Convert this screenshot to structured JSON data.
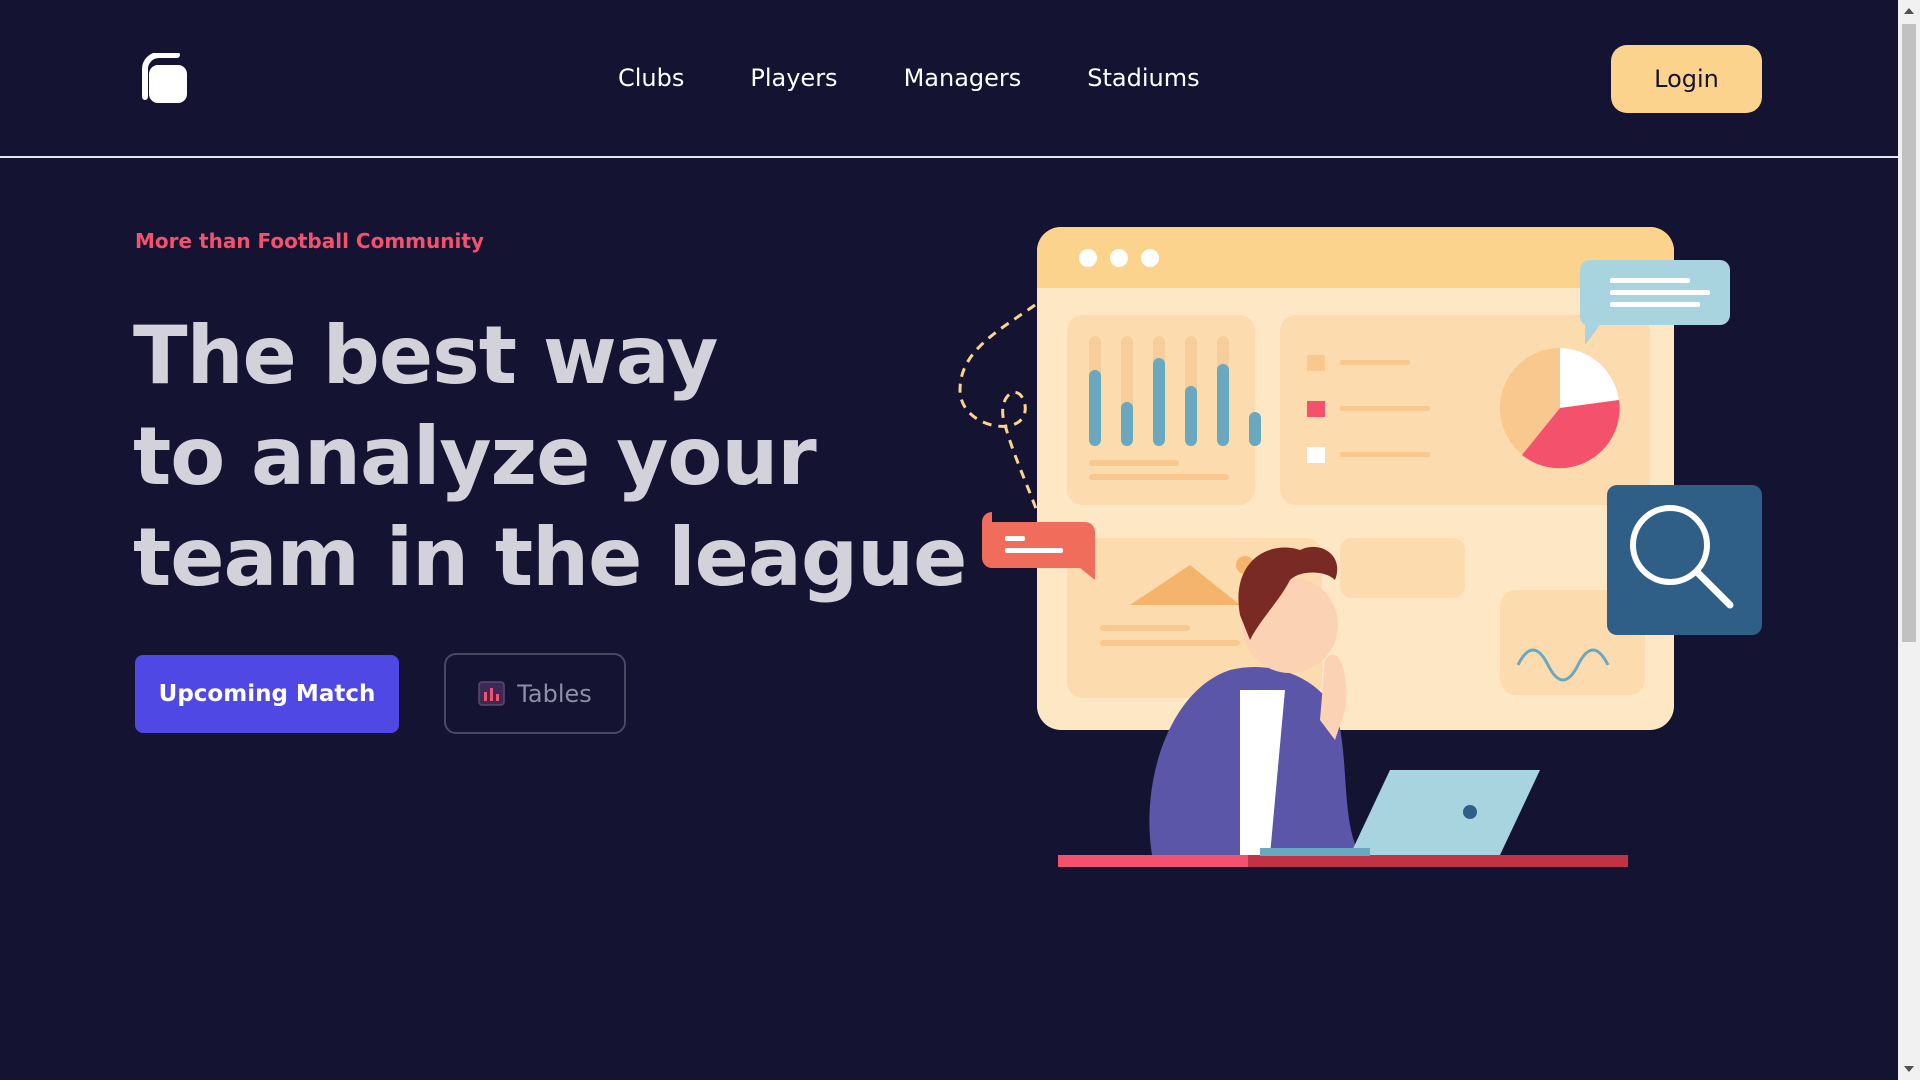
{
  "header": {
    "logo_icon": "app-logo-icon",
    "nav": [
      {
        "label": "Clubs"
      },
      {
        "label": "Players"
      },
      {
        "label": "Managers"
      },
      {
        "label": "Stadiums"
      }
    ],
    "login_label": "Login"
  },
  "hero": {
    "eyebrow": "More than Football Community",
    "headline": [
      "The best way",
      "to analyze your",
      "team in the league"
    ],
    "primary_button": "Upcoming Match",
    "secondary_button": "Tables",
    "secondary_icon": "bar-chart-icon",
    "illustration_icon": "analytics-dashboard-illustration"
  },
  "colors": {
    "background": "#141332",
    "accent_red": "#f4516c",
    "primary": "#5048e5",
    "login_bg": "#fbd38d",
    "headline": "#d3d1da"
  }
}
